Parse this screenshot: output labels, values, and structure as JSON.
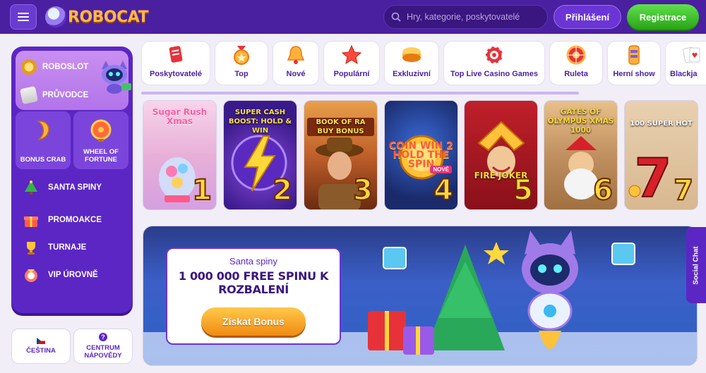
{
  "header": {
    "logo_text": "ROBOCAT",
    "search_placeholder": "Hry, kategorie, poskytovatelé",
    "login_label": "Přihlášení",
    "register_label": "Registrace"
  },
  "sidebar": {
    "roboslot_label": "ROBOSLOT",
    "pruvodce_label": "PRŮVODCE",
    "bonus_crab_label": "BONUS CRAB",
    "wheel_label": "WHEEL OF FORTUNE",
    "items": [
      {
        "label": "SANTA SPINY",
        "icon": "christmas-tree-icon"
      },
      {
        "label": "PROMOAKCE",
        "icon": "gift-icon"
      },
      {
        "label": "TURNAJE",
        "icon": "trophy-icon"
      },
      {
        "label": "VIP ÚROVNĚ",
        "icon": "vip-icon"
      }
    ],
    "language_label": "ČEŠTINA",
    "help_label": "CENTRUM NÁPOVĚDY"
  },
  "categories": [
    {
      "label": "Poskytovatelé",
      "icon": "providers-icon"
    },
    {
      "label": "Top",
      "icon": "top-medal-icon"
    },
    {
      "label": "Nové",
      "icon": "bell-icon"
    },
    {
      "label": "Populární",
      "icon": "star-icon"
    },
    {
      "label": "Exkluzivní",
      "icon": "diamond-icon"
    },
    {
      "label": "Top Live Casino Games",
      "icon": "chip-icon"
    },
    {
      "label": "Ruleta",
      "icon": "roulette-icon"
    },
    {
      "label": "Herní show",
      "icon": "game-show-icon"
    },
    {
      "label": "Blackja",
      "icon": "cards-icon"
    }
  ],
  "games": [
    {
      "title": "Sugar Rush Xmas",
      "rank": "1"
    },
    {
      "title": "SUPER CASH BOOST: HOLD & WIN",
      "rank": "2"
    },
    {
      "title": "BOOK OF RA BUY BONUS",
      "rank": "3"
    },
    {
      "title": "COIN WIN 2 HOLD THE SPIN",
      "rank": "4",
      "badge": "NOVÉ"
    },
    {
      "title": "FIRE JOKER",
      "rank": "5"
    },
    {
      "title": "GATES OF OLYMPUS XMAS 1000",
      "rank": "6"
    },
    {
      "title": "100 SUPER HOT",
      "rank": "7"
    }
  ],
  "banner": {
    "subtitle": "Santa spiny",
    "title": "1 000 000 FREE SPINU K ROZBALENÍ",
    "button_label": "Získat Bonus"
  },
  "social_chat_label": "Social Chat",
  "colors": {
    "header_bg": "#4a1fa0",
    "sidebar_bg": "#5b26c4",
    "register_green": "#2aa318",
    "bonus_orange": "#f08a12"
  }
}
